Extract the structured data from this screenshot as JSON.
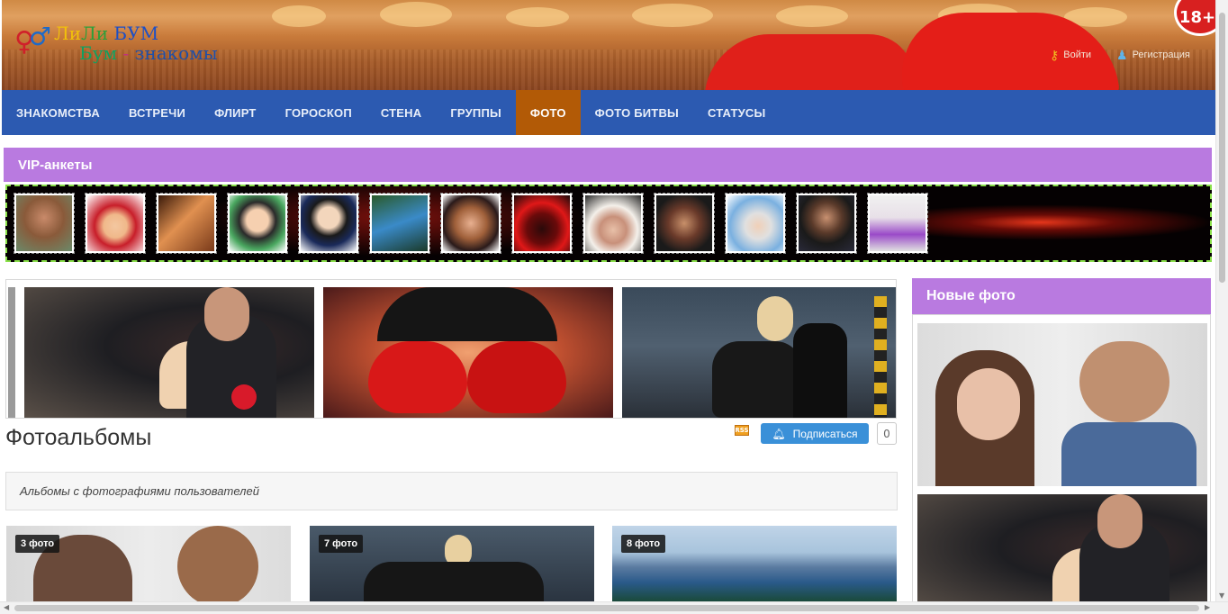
{
  "header": {
    "logo_line1_part1": "Ли",
    "logo_line1_part2": "Ли",
    "logo_line1_part3": " БУМ",
    "logo_line2_part1": "Бум",
    "logo_line2_part2": " - ",
    "logo_line2_part3": "знакомы",
    "age_badge": "18+",
    "login_label": "Войти",
    "register_label": "Регистрация"
  },
  "nav": {
    "items": [
      "ЗНАКОМСТВА",
      "ВСТРЕЧИ",
      "ФЛИРТ",
      "ГОРОСКОП",
      "СТЕНА",
      "ГРУППЫ",
      "ФОТО",
      "ФОТО БИТВЫ",
      "СТАТУСЫ"
    ],
    "active": "ФОТО"
  },
  "vip": {
    "title": "VIP-анкеты"
  },
  "albums_section": {
    "title": "Фотоальбомы",
    "rss_label": "RSS",
    "subscribe_label": "Подписаться",
    "subscribe_count": "0",
    "description": "Альбомы с фотографиями пользователей",
    "albums": [
      {
        "count_label": "3 фото"
      },
      {
        "count_label": "7 фото"
      },
      {
        "count_label": "8 фото"
      }
    ]
  },
  "sidebar": {
    "title": "Новые фото"
  },
  "colors": {
    "nav_bg": "#2c5ab1",
    "nav_active": "#b25a06",
    "section_header": "#b97ae0",
    "subscribe_button": "#3a90d8"
  }
}
